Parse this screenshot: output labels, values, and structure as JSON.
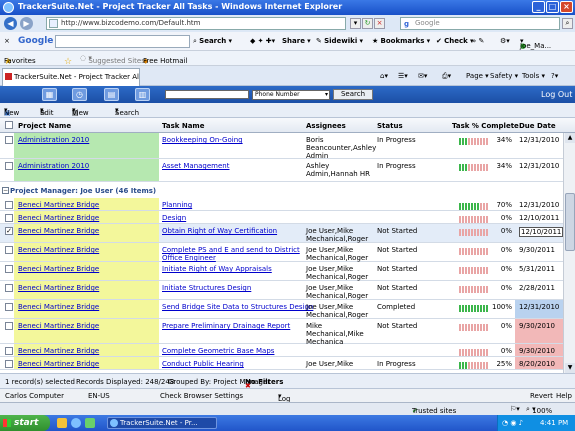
{
  "browser": {
    "window_title": "TrackerSuite.Net - Project Tracker All Tasks - Windows Internet Explorer",
    "url": "http://www.bizcodemo.com/Default.htm",
    "search_placeholder": "Google",
    "google_toolbar": {
      "logo": "Google",
      "search_label": "Search",
      "share_label": "Share",
      "sidewiki_label": "Sidewiki",
      "bookmarks_label": "Bookmarks",
      "check_label": "Check",
      "user_label": "Joe_Ma..."
    },
    "favorites": {
      "favorites_label": "Favorites",
      "suggested_label": "Suggested Sites",
      "hotmail_label": "Free Hotmail"
    },
    "tab_title": "TrackerSuite.Net - Project Tracker All Tasks",
    "commands": {
      "page": "Page",
      "safety": "Safety",
      "tools": "Tools"
    }
  },
  "app": {
    "search_value": "",
    "search_field_option": "Phone Number",
    "search_button": "Search",
    "logout": "Log Out",
    "toolbar": {
      "new": "New",
      "edit": "Edit",
      "view": "View",
      "search": "Search"
    },
    "columns": {
      "project": "Project Name",
      "task": "Task Name",
      "assignees": "Assignees",
      "status": "Status",
      "pct": "Task % Complete",
      "due": "Due Date"
    },
    "group_header": "Project Manager: Joe User (46 Items)",
    "rows_top": [
      {
        "project": "Administration 2010",
        "task": "Bookkeeping On-Going",
        "assignees": "Boris\nBeancounter,Ashley\nAdmin",
        "status": "In Progress",
        "pct": "34%",
        "pct_value": 34,
        "due": "12/31/2010",
        "checked": false,
        "color": "#b6e8b0"
      },
      {
        "project": "Administration 2010",
        "task": "Asset Management",
        "assignees": "Ashley\nAdmin,Hannah HR",
        "status": "In Progress",
        "pct": "34%",
        "pct_value": 34,
        "due": "12/31/2010",
        "checked": false,
        "color": "#b6e8b0"
      }
    ],
    "rows_group": [
      {
        "project": "Beneci Martinez Bridge",
        "task": "Planning",
        "assignees": "",
        "status": "",
        "pct": "70%",
        "pct_value": 70,
        "due": "12/31/2010",
        "checked": false,
        "color": "#f3f79b",
        "due_color": ""
      },
      {
        "project": "Beneci Martinez Bridge",
        "task": "Design",
        "assignees": "",
        "status": "",
        "pct": "0%",
        "pct_value": 0,
        "due": "12/10/2011",
        "checked": false,
        "color": "#f3f79b",
        "due_color": ""
      },
      {
        "project": "Beneci Martinez Bridge",
        "task": "Obtain Right of Way Certification",
        "assignees": "Joe User,Mike\nMechanical,Roger",
        "status": "Not Started",
        "pct": "0%",
        "pct_value": 0,
        "due": "12/10/2011",
        "checked": true,
        "color": "#f3f79b",
        "due_color": "",
        "selected": true
      },
      {
        "project": "Beneci Martinez Bridge",
        "task": "Complete PS and E and send to District\nOffice Engineer",
        "assignees": "Joe User,Mike\nMechanical,Roger",
        "status": "Not Started",
        "pct": "0%",
        "pct_value": 0,
        "due": "9/30/2011",
        "checked": false,
        "color": "#f3f79b",
        "due_color": ""
      },
      {
        "project": "Beneci Martinez Bridge",
        "task": "Initiate Right of Way Appraisals",
        "assignees": "Joe User,Mike\nMechanical,Roger",
        "status": "Not Started",
        "pct": "0%",
        "pct_value": 0,
        "due": "5/31/2011",
        "checked": false,
        "color": "#f3f79b",
        "due_color": ""
      },
      {
        "project": "Beneci Martinez Bridge",
        "task": "Initiate Structures Design",
        "assignees": "Joe User,Mike\nMechanical,Roger",
        "status": "Not Started",
        "pct": "0%",
        "pct_value": 0,
        "due": "2/28/2011",
        "checked": false,
        "color": "#f3f79b",
        "due_color": ""
      },
      {
        "project": "Beneci Martinez Bridge",
        "task": "Send Bridge Site Data to Structures Design",
        "assignees": "Joe User,Mike\nMechanical,Roger",
        "status": "Completed",
        "pct": "100%",
        "pct_value": 100,
        "due": "12/31/2010",
        "checked": false,
        "color": "#f3f79b",
        "due_color": "#b9d2ef"
      },
      {
        "project": "Beneci Martinez Bridge",
        "task": "Prepare Preliminary Drainage Report",
        "assignees": "Mike\nMechanical,Mike\nMechanica",
        "status": "Not Started",
        "pct": "0%",
        "pct_value": 0,
        "due": "9/30/2010",
        "checked": false,
        "color": "#f3f79b",
        "due_color": "#f2b8b8"
      },
      {
        "project": "Beneci Martinez Bridge",
        "task": "Complete Geometric Base Maps",
        "assignees": "",
        "status": "",
        "pct": "0%",
        "pct_value": 0,
        "due": "9/30/2010",
        "checked": false,
        "color": "#f3f79b",
        "due_color": "#f2b8b8"
      },
      {
        "project": "Beneci Martinez Bridge",
        "task": "Conduct Public Hearing",
        "assignees": "Joe User,Mike",
        "status": "In Progress",
        "pct": "25%",
        "pct_value": 25,
        "due": "8/20/2010",
        "checked": false,
        "color": "#f3f79b",
        "due_color": "#f2b8b8"
      }
    ],
    "footer": {
      "selected": "1 record(s) selected",
      "displayed": "Records Displayed: 248/248",
      "grouped": "Grouped By: Project Manager",
      "filters": "No Filters"
    },
    "status": {
      "computer": "Carlos Computer",
      "locale": "EN-US",
      "settings": "Check Browser Settings",
      "log": "Log",
      "revert": "Revert",
      "help": "Help"
    }
  },
  "ie_status": {
    "zone": "Trusted sites",
    "zoom": "100%"
  },
  "taskbar": {
    "start": "start",
    "task": "TrackerSuite.Net - Pr...",
    "time": "4:41 PM"
  }
}
